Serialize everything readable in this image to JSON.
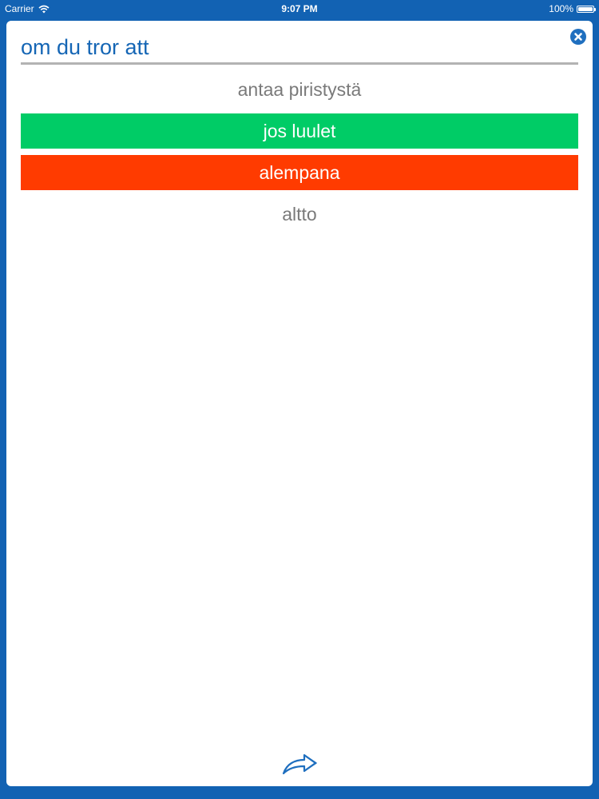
{
  "status_bar": {
    "carrier": "Carrier",
    "time": "9:07 PM",
    "battery": "100%",
    "battery_level": 1.0,
    "wifi_icon": "wifi-icon",
    "battery_icon": "battery-icon"
  },
  "quiz": {
    "question": "om du tror att",
    "options": [
      {
        "label": "antaa piristystä",
        "state": "neutral"
      },
      {
        "label": "jos luulet",
        "state": "correct"
      },
      {
        "label": "alempana",
        "state": "wrong"
      },
      {
        "label": "altto",
        "state": "neutral"
      }
    ]
  },
  "icons": {
    "close": "close-icon",
    "next": "forward-arrow-icon"
  },
  "colors": {
    "background": "#1262b3",
    "accent": "#1566b5",
    "correct": "#00cc66",
    "wrong": "#ff3b00",
    "neutral_text": "#7a7a7a"
  }
}
